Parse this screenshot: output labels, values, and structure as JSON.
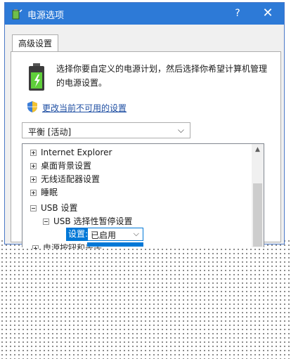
{
  "window": {
    "title": "电源选项",
    "help_label": "?",
    "close_label": "✕"
  },
  "tabs": [
    {
      "label": "高级设置"
    }
  ],
  "description": "选择你要自定义的电源计划，然后选择你希望计算机管理的电源设置。",
  "change_link": "更改当前不可用的设置",
  "plan_select": {
    "value": "平衡 [活动]"
  },
  "tree": {
    "items": [
      {
        "label": "Internet Explorer",
        "expanded": false
      },
      {
        "label": "桌面背景设置",
        "expanded": false
      },
      {
        "label": "无线适配器设置",
        "expanded": false
      },
      {
        "label": "睡眠",
        "expanded": false
      },
      {
        "label": "USB 设置",
        "expanded": true
      },
      {
        "label": "USB 选择性暂停设置",
        "expanded": true
      }
    ],
    "setting_label": "设置:",
    "setting_value": "已启用",
    "partial_item": "电源按钮和盖子"
  },
  "colors": {
    "titlebar": "#2d7ad7",
    "selection": "#0078d7",
    "link": "#1f4fa3"
  }
}
